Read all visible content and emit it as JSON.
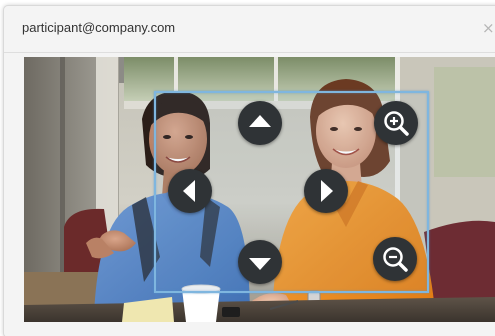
{
  "window": {
    "title": "participant@company.com",
    "close_glyph": "×"
  },
  "video": {
    "description_icon": "video-feed",
    "zoom_box_color": "#7fb6df"
  },
  "controls": {
    "pan_up_icon": "up-arrow-icon",
    "pan_left_icon": "left-arrow-icon",
    "pan_right_icon": "right-arrow-icon",
    "pan_down_icon": "down-arrow-icon",
    "zoom_in_icon": "zoom-in-icon",
    "zoom_out_icon": "zoom-out-icon",
    "button_color": "#2f3336"
  }
}
